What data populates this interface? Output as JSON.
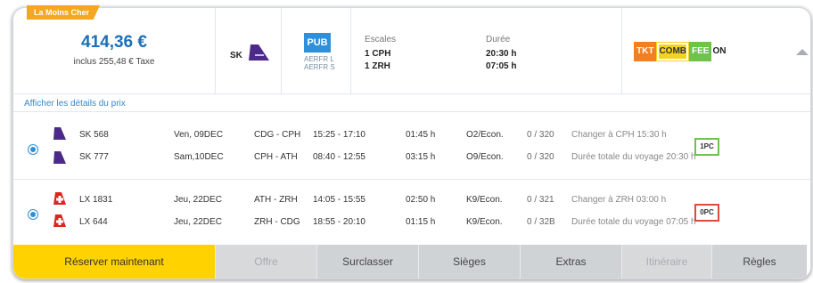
{
  "badge": "La Moins Cher",
  "summary": {
    "price": "414,36 €",
    "tax": "inclus 255,48 € Taxe",
    "carrier": "SK",
    "fare_type": "PUB",
    "fare_sub": [
      "AERFR L",
      "AERFR S"
    ],
    "stops_label": "Escales",
    "stops": [
      "1  CPH",
      "1  ZRH"
    ],
    "duration_label": "Durée",
    "durations": [
      "20:30 h",
      "07:05 h"
    ],
    "codes": [
      "TKT",
      "COMB",
      "FEE",
      "ON"
    ]
  },
  "details_link": "Afficher les détails du prix",
  "option_groups": [
    {
      "baggage": "1PC",
      "segments": [
        {
          "flight": "SK 568",
          "date": "Ven, 09DEC",
          "route": "CDG  -  CPH",
          "times": "15:25  -  17:10",
          "duration": "01:45 h",
          "class": "O2/Econ.",
          "seats": "0 / 320",
          "info": "Changer à CPH 15:30 h"
        },
        {
          "flight": "SK 777",
          "date": "Sam,10DEC",
          "route": "CPH  -  ATH",
          "times": "08:40  -  12:55",
          "duration": "03:15 h",
          "class": "O9/Econ.",
          "seats": "0 / 320",
          "info": "Durée totale du voyage 20:30 h"
        }
      ]
    },
    {
      "baggage": "0PC",
      "segments": [
        {
          "flight": "LX 1831",
          "date": "Jeu,  22DEC",
          "route": "ATH  -  ZRH",
          "times": "14:05  -  15:55",
          "duration": "02:50 h",
          "class": "K9/Econ.",
          "seats": "0 / 321",
          "info": "Changer à ZRH 03:00 h"
        },
        {
          "flight": "LX 644",
          "date": "Jeu,  22DEC",
          "route": "ZRH  -  CDG",
          "times": "18:55  -  20:10",
          "duration": "01:15 h",
          "class": "K9/Econ.",
          "seats": "0 / 32B",
          "info": "Durée totale du voyage 07:05 h"
        }
      ]
    }
  ],
  "footer": {
    "book": "Réserver maintenant",
    "offer": "Offre",
    "upgrade": "Surclasser",
    "seats": "Sièges",
    "extras": "Extras",
    "itinerary": "Itinéraire",
    "rules": "Règles"
  },
  "colors": {
    "accent": "#1c6fb8",
    "book": "#ffd200",
    "badge": "#f6a721",
    "sas": "#4b2a8a",
    "swiss": "#e1231e"
  }
}
